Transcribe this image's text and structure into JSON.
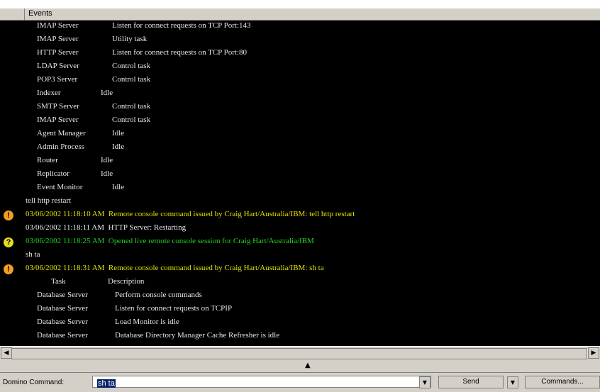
{
  "header": {
    "events_column": "Events"
  },
  "console": {
    "lines": [
      {
        "c1": "IMAP Server",
        "c2": "Listen for connect requests on TCP Port:143",
        "icon": "",
        "style": "white"
      },
      {
        "c1": "IMAP Server",
        "c2": "Utility task",
        "icon": "",
        "style": "white"
      },
      {
        "c1": "HTTP Server",
        "c2": "Listen for connect requests on TCP Port:80",
        "icon": "",
        "style": "white"
      },
      {
        "c1": "LDAP Server",
        "c2": "Control task",
        "icon": "",
        "style": "white"
      },
      {
        "c1": "POP3 Server",
        "c2": "Control task",
        "icon": "",
        "style": "white"
      },
      {
        "c1": "Indexer",
        "c2": "Idle",
        "icon": "",
        "style": "white"
      },
      {
        "c1": "SMTP Server",
        "c2": "Control task",
        "icon": "",
        "style": "white"
      },
      {
        "c1": "IMAP Server",
        "c2": "Control task",
        "icon": "",
        "style": "white"
      },
      {
        "c1": "Agent Manager",
        "c2": "Idle",
        "icon": "",
        "style": "white"
      },
      {
        "c1": "Admin Process",
        "c2": "Idle",
        "icon": "",
        "style": "white"
      },
      {
        "c1": "Router",
        "c2": "Idle",
        "icon": "",
        "style": "white"
      },
      {
        "c1": "Replicator",
        "c2": "Idle",
        "icon": "",
        "style": "white"
      },
      {
        "c1": "Event Monitor",
        "c2": "Idle",
        "icon": "",
        "style": "white"
      },
      {
        "c1": "tell http restart",
        "c2": "",
        "icon": "",
        "style": "plain"
      },
      {
        "c1": "03/06/2002 11:18:10 AM  Remote console command issued by Craig Hart/Australia/IBM: tell http restart",
        "c2": "",
        "icon": "warning-icon",
        "style": "yellow"
      },
      {
        "c1": "03/06/2002 11:18:11 AM  HTTP Server: Restarting",
        "c2": "",
        "icon": "",
        "style": "plain"
      },
      {
        "c1": "03/06/2002 11:18:25 AM  Opened live remote console session for Craig Hart/Australia/IBM",
        "c2": "",
        "icon": "question-icon",
        "style": "green"
      },
      {
        "c1": "sh ta",
        "c2": "",
        "icon": "",
        "style": "plain"
      },
      {
        "c1": "03/06/2002 11:18:31 AM  Remote console command issued by Craig Hart/Australia/IBM: sh ta",
        "c2": "",
        "icon": "warning-icon",
        "style": "yellow"
      },
      {
        "c1": "Task",
        "c2": "Description",
        "icon": "",
        "style": "header"
      },
      {
        "c1": "Database Server",
        "c2": "Perform console commands",
        "icon": "",
        "style": "white"
      },
      {
        "c1": "Database Server",
        "c2": "Listen for connect requests on TCPIP",
        "icon": "",
        "style": "white"
      },
      {
        "c1": "Database Server",
        "c2": "Load Monitor is idle",
        "icon": "",
        "style": "white"
      },
      {
        "c1": "Database Server",
        "c2": "Database Directory Manager Cache Refresher is idle",
        "icon": "",
        "style": "white"
      }
    ]
  },
  "command": {
    "label": "Domino Command:",
    "value": "sh ta",
    "send_label": "Send",
    "commands_label": "Commands..."
  }
}
